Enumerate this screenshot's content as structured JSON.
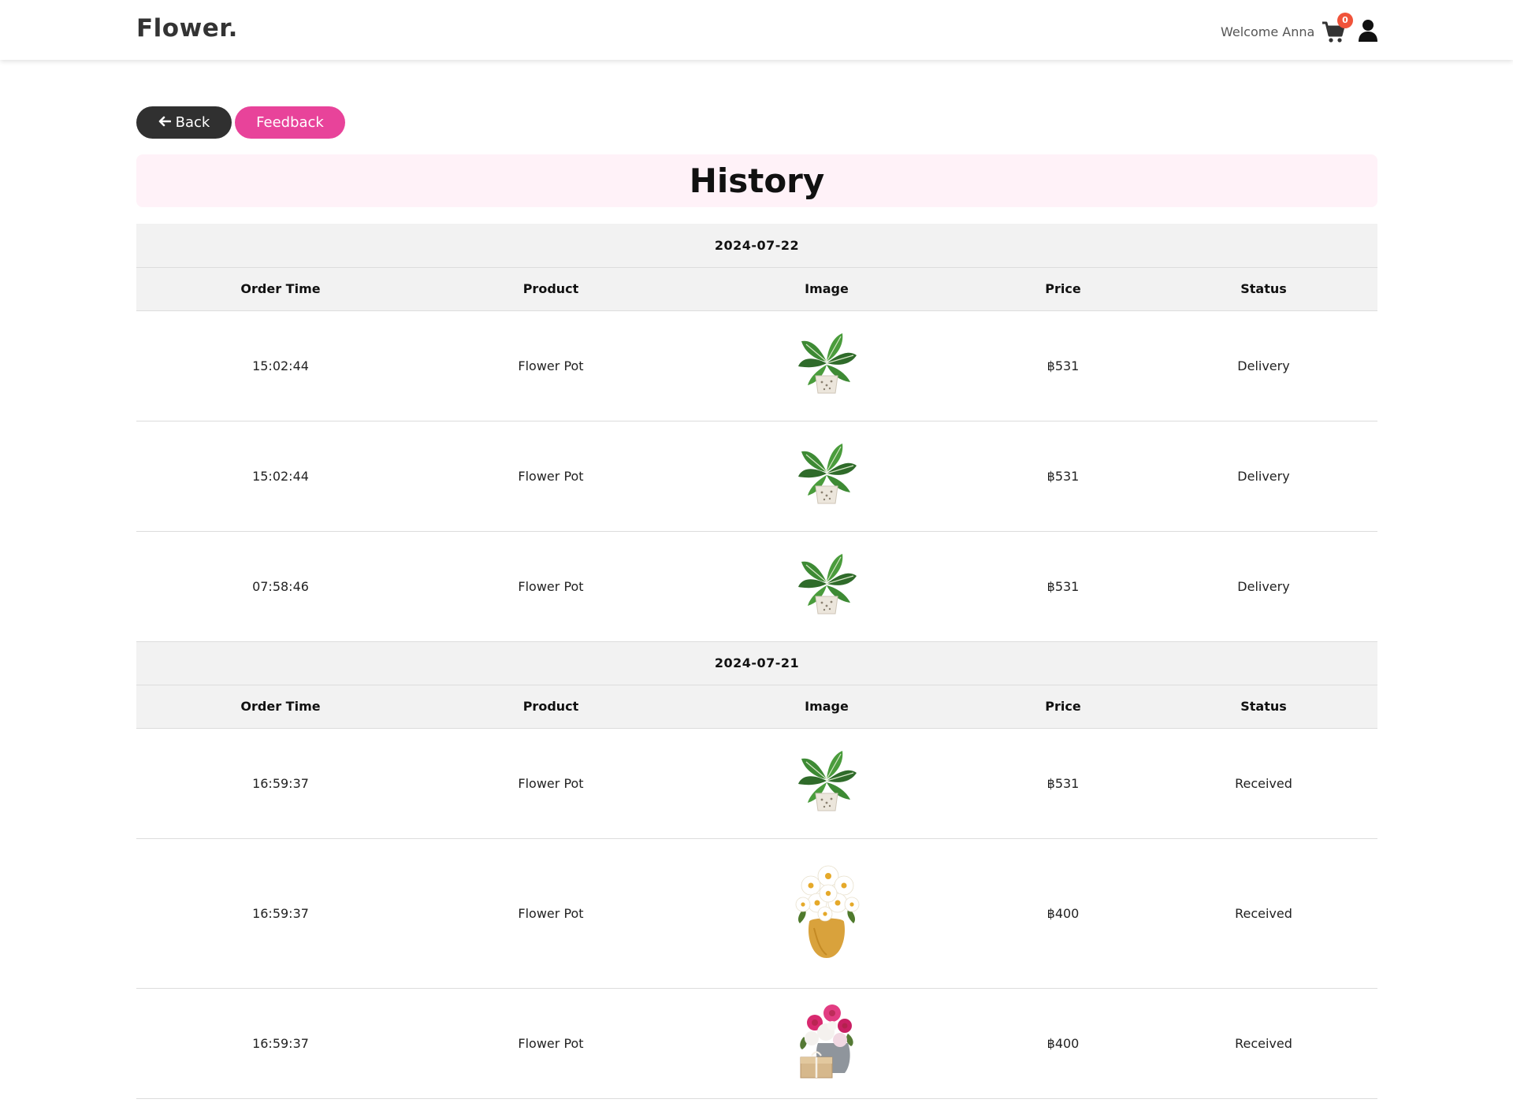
{
  "header": {
    "brand": "Flower.",
    "welcome": "Welcome Anna",
    "cart_count": "0",
    "cart_icon": "shopping-cart-icon",
    "user_icon": "user-icon"
  },
  "actions": {
    "back_label": "Back",
    "feedback_label": "Feedback"
  },
  "page_title": "History",
  "colors": {
    "feedback_pink": "#e8439a",
    "back_dark": "#303030",
    "delivery_red": "#e0242a",
    "received_green": "#1e7f2a",
    "badge": "#f0533a"
  },
  "columns": [
    "Order Time",
    "Product",
    "Image",
    "Price",
    "Status"
  ],
  "groups": [
    {
      "date": "2024-07-22",
      "orders": [
        {
          "time": "15:02:44",
          "product": "Flower Pot",
          "image": "monstera-plant",
          "price": "฿531",
          "status": "Delivery"
        },
        {
          "time": "15:02:44",
          "product": "Flower Pot",
          "image": "monstera-plant",
          "price": "฿531",
          "status": "Delivery"
        },
        {
          "time": "07:58:46",
          "product": "Flower Pot",
          "image": "monstera-plant",
          "price": "฿531",
          "status": "Delivery"
        }
      ]
    },
    {
      "date": "2024-07-21",
      "orders": [
        {
          "time": "16:59:37",
          "product": "Flower Pot",
          "image": "monstera-plant",
          "price": "฿531",
          "status": "Received"
        },
        {
          "time": "16:59:37",
          "product": "Flower Pot",
          "image": "daisy-vase",
          "price": "฿400",
          "status": "Received"
        },
        {
          "time": "16:59:37",
          "product": "Flower Pot",
          "image": "rose-vase-gift",
          "price": "฿400",
          "status": "Received"
        }
      ]
    }
  ]
}
